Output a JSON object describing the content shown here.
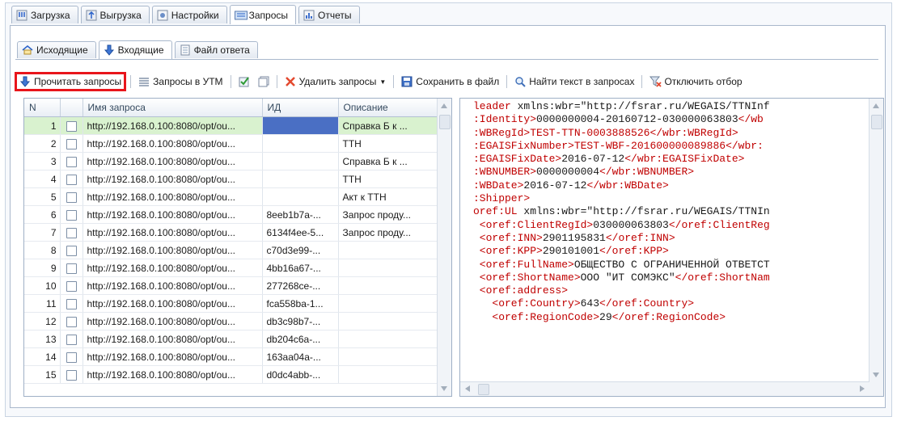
{
  "main_tabs": [
    {
      "label": "Загрузка",
      "icon": "download-icon"
    },
    {
      "label": "Выгрузка",
      "icon": "upload-icon"
    },
    {
      "label": "Настройки",
      "icon": "settings-icon"
    },
    {
      "label": "Запросы",
      "icon": "requests-icon",
      "active": true
    },
    {
      "label": "Отчеты",
      "icon": "chart-icon"
    }
  ],
  "sub_tabs": [
    {
      "label": "Исходящие",
      "icon": "home-icon"
    },
    {
      "label": "Входящие",
      "icon": "arrow-down-icon",
      "active": true
    },
    {
      "label": "Файл ответа",
      "icon": "file-icon"
    }
  ],
  "toolbar": {
    "read_requests": "Прочитать запросы",
    "requests_utm": "Запросы в УТМ",
    "delete_requests": "Удалить запросы",
    "save_to_file": "Сохранить в файл",
    "find_text": "Найти текст в запросах",
    "disable_filter": "Отключить отбор"
  },
  "grid": {
    "columns": [
      "N",
      "",
      "Имя запроса",
      "ИД",
      "Описание"
    ],
    "rows": [
      {
        "n": "1",
        "name": "http://192.168.0.100:8080/opt/ou...",
        "id": "",
        "desc": "Справка Б к ...",
        "selected": true
      },
      {
        "n": "2",
        "name": "http://192.168.0.100:8080/opt/ou...",
        "id": "",
        "desc": "ТТН"
      },
      {
        "n": "3",
        "name": "http://192.168.0.100:8080/opt/ou...",
        "id": "",
        "desc": "Справка Б к ..."
      },
      {
        "n": "4",
        "name": "http://192.168.0.100:8080/opt/ou...",
        "id": "",
        "desc": "ТТН"
      },
      {
        "n": "5",
        "name": "http://192.168.0.100:8080/opt/ou...",
        "id": "",
        "desc": "Акт к ТТН"
      },
      {
        "n": "6",
        "name": "http://192.168.0.100:8080/opt/ou...",
        "id": "8eeb1b7a-...",
        "desc": "Запрос проду..."
      },
      {
        "n": "7",
        "name": "http://192.168.0.100:8080/opt/ou...",
        "id": "6134f4ee-5...",
        "desc": "Запрос проду..."
      },
      {
        "n": "8",
        "name": "http://192.168.0.100:8080/opt/ou...",
        "id": "c70d3e99-...",
        "desc": ""
      },
      {
        "n": "9",
        "name": "http://192.168.0.100:8080/opt/ou...",
        "id": "4bb16a67-...",
        "desc": ""
      },
      {
        "n": "10",
        "name": "http://192.168.0.100:8080/opt/ou...",
        "id": "277268ce-...",
        "desc": ""
      },
      {
        "n": "11",
        "name": "http://192.168.0.100:8080/opt/ou...",
        "id": "fca558ba-1...",
        "desc": ""
      },
      {
        "n": "12",
        "name": "http://192.168.0.100:8080/opt/ou...",
        "id": "db3c98b7-...",
        "desc": ""
      },
      {
        "n": "13",
        "name": "http://192.168.0.100:8080/opt/ou...",
        "id": "db204c6a-...",
        "desc": ""
      },
      {
        "n": "14",
        "name": "http://192.168.0.100:8080/opt/ou...",
        "id": "163aa04a-...",
        "desc": ""
      },
      {
        "n": "15",
        "name": "http://192.168.0.100:8080/opt/ou...",
        "id": "d0dc4abb-...",
        "desc": ""
      }
    ]
  },
  "xml_lines": [
    [
      {
        "t": "t",
        "s": "leader "
      },
      {
        "t": "a",
        "s": "xmlns:wbr=\"http://fsrar.ru/WEGAIS/TTNInf"
      }
    ],
    [
      {
        "t": "t",
        "s": ":Identity>"
      },
      {
        "t": "v",
        "s": "0000000004-20160712-030000063803"
      },
      {
        "t": "t",
        "s": "</wb"
      }
    ],
    [
      {
        "t": "t",
        "s": ":WBRegId>"
      },
      {
        "t": "t",
        "s": "TEST-TTN-0003888526"
      },
      {
        "t": "t",
        "s": "</wbr:WBRegId>"
      }
    ],
    [
      {
        "t": "t",
        "s": ":EGAISFixNumber>"
      },
      {
        "t": "t",
        "s": "TEST-WBF-201600000089886"
      },
      {
        "t": "t",
        "s": "</wbr:"
      }
    ],
    [
      {
        "t": "t",
        "s": ":EGAISFixDate>"
      },
      {
        "t": "v",
        "s": "2016-07-12"
      },
      {
        "t": "t",
        "s": "</wbr:EGAISFixDate>"
      }
    ],
    [
      {
        "t": "t",
        "s": ":WBNUMBER>"
      },
      {
        "t": "v",
        "s": "0000000004"
      },
      {
        "t": "t",
        "s": "</wbr:WBNUMBER>"
      }
    ],
    [
      {
        "t": "t",
        "s": ":WBDate>"
      },
      {
        "t": "v",
        "s": "2016-07-12"
      },
      {
        "t": "t",
        "s": "</wbr:WBDate>"
      }
    ],
    [
      {
        "t": "t",
        "s": ":Shipper>"
      }
    ],
    [
      {
        "t": "t",
        "s": "oref:UL "
      },
      {
        "t": "a",
        "s": "xmlns:wbr=\"http://fsrar.ru/WEGAIS/TTNIn"
      }
    ],
    [
      {
        "t": "t",
        "s": " <oref:ClientRegId>"
      },
      {
        "t": "v",
        "s": "030000063803"
      },
      {
        "t": "t",
        "s": "</oref:ClientReg"
      }
    ],
    [
      {
        "t": "t",
        "s": " <oref:INN>"
      },
      {
        "t": "v",
        "s": "2901195831"
      },
      {
        "t": "t",
        "s": "</oref:INN>"
      }
    ],
    [
      {
        "t": "t",
        "s": " <oref:KPP>"
      },
      {
        "t": "v",
        "s": "290101001"
      },
      {
        "t": "t",
        "s": "</oref:KPP>"
      }
    ],
    [
      {
        "t": "t",
        "s": " <oref:FullName>"
      },
      {
        "t": "v",
        "s": "ОБЩЕСТВО С ОГРАНИЧЕННОЙ ОТВЕТСТ"
      }
    ],
    [
      {
        "t": "t",
        "s": " <oref:ShortName>"
      },
      {
        "t": "v",
        "s": "ООО \"ИТ СОМЭКС\""
      },
      {
        "t": "t",
        "s": "</oref:ShortNam"
      }
    ],
    [
      {
        "t": "t",
        "s": " <oref:address>"
      }
    ],
    [
      {
        "t": "t",
        "s": "   <oref:Country>"
      },
      {
        "t": "v",
        "s": "643"
      },
      {
        "t": "t",
        "s": "</oref:Country>"
      }
    ],
    [
      {
        "t": "t",
        "s": "   <oref:RegionCode>"
      },
      {
        "t": "v",
        "s": "29"
      },
      {
        "t": "t",
        "s": "</oref:RegionCode>"
      }
    ]
  ]
}
